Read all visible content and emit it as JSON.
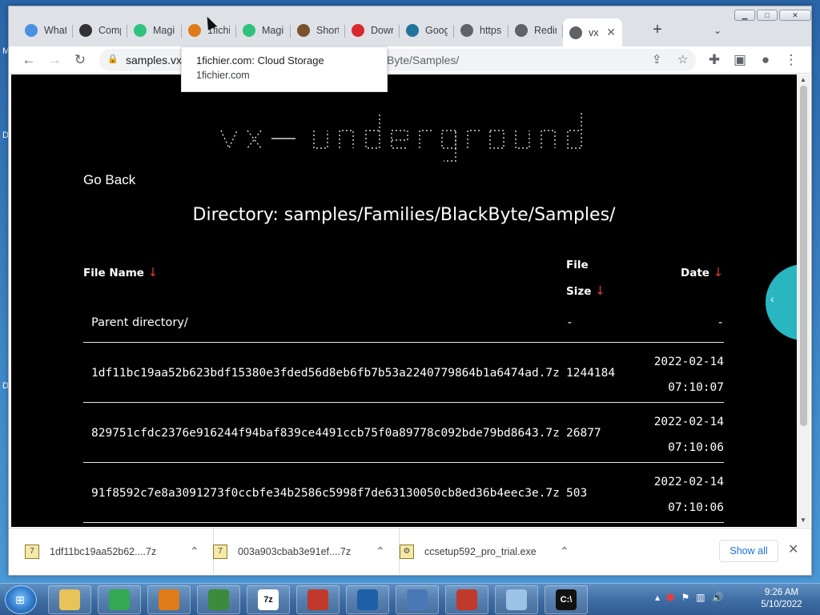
{
  "tabs": [
    {
      "label": "What",
      "icon": "p-badge-icon",
      "color": "#4a90e2"
    },
    {
      "label": "Comp",
      "icon": "copy-icon",
      "color": "#333333"
    },
    {
      "label": "Magi",
      "icon": "magisk-icon",
      "color": "#2ec27e"
    },
    {
      "label": "1fichi",
      "icon": "fichier-icon",
      "color": "#e07b1a"
    },
    {
      "label": "Magi",
      "icon": "magisk-icon",
      "color": "#2ec27e"
    },
    {
      "label": "Short",
      "icon": "shortlink-icon",
      "color": "#7a5230"
    },
    {
      "label": "Down",
      "icon": "mega-icon",
      "color": "#d9272e"
    },
    {
      "label": "Goog",
      "icon": "wordpress-icon",
      "color": "#21759b"
    },
    {
      "label": "https:",
      "icon": "globe-icon",
      "color": "#5f6368"
    },
    {
      "label": "Redir",
      "icon": "globe-icon",
      "color": "#5f6368"
    },
    {
      "label": "vx",
      "icon": "globe-icon",
      "color": "#5f6368"
    }
  ],
  "address": {
    "host": "samples.vx-",
    "rest": "Byte/Samples/"
  },
  "tooltip": {
    "title": "1fichier.com: Cloud Storage",
    "domain": "1fichier.com"
  },
  "page": {
    "go_back": "Go Back",
    "directory": "Directory: samples/Families/BlackByte/Samples/",
    "headers": {
      "name": "File Name",
      "size_line1": "File",
      "size_line2": "Size",
      "date": "Date",
      "arrow": "↓"
    },
    "parent": {
      "name": "Parent directory/",
      "size": "-",
      "date": "-"
    },
    "files": [
      {
        "name": "1df11bc19aa52b623bdf15380e3fded56d8eb6fb7b53a2240779864b1a6474ad.7z",
        "size": "1244184",
        "date": "2022-02-14",
        "time": "07:10:07"
      },
      {
        "name": "829751cfdc2376e916244f94baf839ce4491ccb75f0a89778c092bde79bd8643.7z",
        "size": "26877",
        "date": "2022-02-14",
        "time": "07:10:06"
      },
      {
        "name": "91f8592c7e8a3091273f0ccbfe34b2586c5998f7de63130050cb8ed36b4eec3e.7z",
        "size": "503",
        "date": "2022-02-14",
        "time": "07:10:06"
      }
    ]
  },
  "downloads": [
    {
      "name": "1df11bc19aa52b62....7z"
    },
    {
      "name": "003a903cbab3e91ef....7z"
    },
    {
      "name": "ccsetup592_pro_trial.exe"
    }
  ],
  "show_all": "Show all",
  "taskbar": {
    "apps": [
      {
        "icon": "folder-icon",
        "label": "",
        "color": "#e8c35a"
      },
      {
        "icon": "chrome-icon",
        "label": "",
        "color": "#34a853"
      },
      {
        "icon": "media-player-icon",
        "label": "",
        "color": "#e07b1a"
      },
      {
        "icon": "network-monitor-icon",
        "label": "",
        "color": "#3c8a3c"
      },
      {
        "icon": "sevenzip-icon",
        "label": "7z",
        "color": "#ffffff"
      },
      {
        "icon": "bug-icon",
        "label": "",
        "color": "#c0392b"
      },
      {
        "icon": "shield-icon",
        "label": "",
        "color": "#1f5fa8"
      },
      {
        "icon": "process-icon",
        "label": "",
        "color": "#4a78b5"
      },
      {
        "icon": "recorder-icon",
        "label": "",
        "color": "#c0392b"
      },
      {
        "icon": "notepad-icon",
        "label": "",
        "color": "#9cc3e6"
      },
      {
        "icon": "cmd-icon",
        "label": "C:\\",
        "color": "#111111"
      }
    ],
    "time": "9:26 AM",
    "date": "5/10/2022"
  }
}
